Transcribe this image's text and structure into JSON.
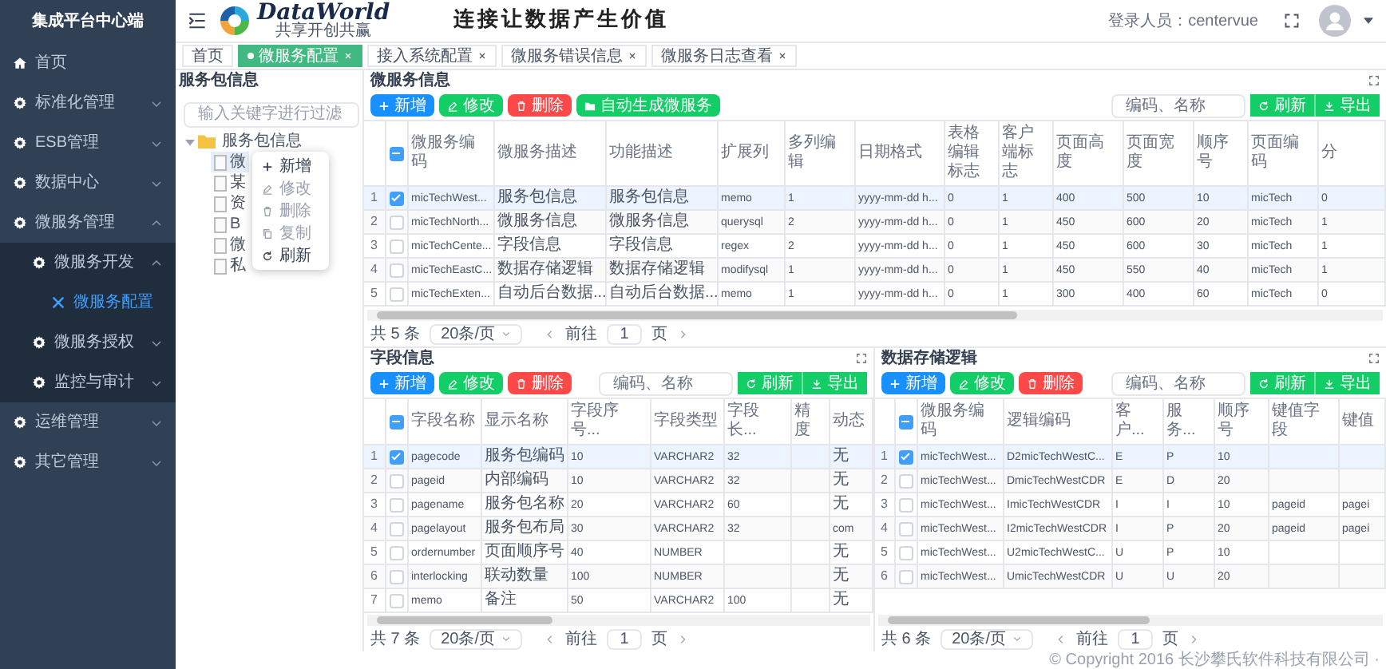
{
  "sidebar": {
    "title": "集成平台中心端",
    "items": [
      {
        "label": "首页",
        "kind": "home",
        "selected": false
      },
      {
        "label": "标准化管理",
        "kind": "group",
        "selected": false,
        "expanded": false
      },
      {
        "label": "ESB管理",
        "kind": "group",
        "selected": false,
        "expanded": false
      },
      {
        "label": "数据中心",
        "kind": "group",
        "selected": false,
        "expanded": false
      },
      {
        "label": "微服务管理",
        "kind": "group",
        "selected": false,
        "expanded": true,
        "children": [
          {
            "label": "微服务开发",
            "kind": "group",
            "selected": false,
            "expanded": true,
            "children": [
              {
                "label": "微服务配置",
                "kind": "page",
                "selected": true
              }
            ]
          },
          {
            "label": "微服务授权",
            "kind": "group",
            "selected": false,
            "expanded": false
          },
          {
            "label": "监控与审计",
            "kind": "group",
            "selected": false,
            "expanded": false
          }
        ]
      },
      {
        "label": "运维管理",
        "kind": "group",
        "selected": false,
        "expanded": false
      },
      {
        "label": "其它管理",
        "kind": "group",
        "selected": false,
        "expanded": false
      }
    ]
  },
  "header": {
    "logo_text": "DataWorld",
    "logo_subtitle": "共享开创共赢",
    "slogan": "连接让数据产生价值",
    "user": "登录人员：centervue"
  },
  "tabs": [
    {
      "label": "首页",
      "selected": false,
      "closable": false
    },
    {
      "label": "微服务配置",
      "selected": true,
      "closable": true
    },
    {
      "label": "接入系统配置",
      "selected": false,
      "closable": true
    },
    {
      "label": "微服务错误信息",
      "selected": false,
      "closable": true
    },
    {
      "label": "微服务日志查看",
      "selected": false,
      "closable": true
    }
  ],
  "tree_panel": {
    "title": "服务包信息",
    "filter_placeholder": "输入关键字进行过滤",
    "root": {
      "label": "服务包信息",
      "expanded": true,
      "children": [
        {
          "label": "微",
          "selected": true
        },
        {
          "label": "某",
          "selected": false
        },
        {
          "label": "资",
          "selected": false
        },
        {
          "label": "B",
          "selected": false
        },
        {
          "label": "微",
          "selected": false
        },
        {
          "label": "私",
          "selected": false
        }
      ]
    },
    "context_menu": [
      {
        "label": "新增",
        "kind": "add",
        "disabled": false
      },
      {
        "label": "修改",
        "kind": "edit",
        "disabled": true
      },
      {
        "label": "删除",
        "kind": "delete",
        "disabled": true
      },
      {
        "label": "复制",
        "kind": "copy",
        "disabled": true
      },
      {
        "label": "刷新",
        "kind": "refresh",
        "disabled": false
      }
    ]
  },
  "panels": [
    {
      "title": "微服务信息",
      "buttons": [
        {
          "label": "新增",
          "kind": "add"
        },
        {
          "label": "修改",
          "kind": "edit"
        },
        {
          "label": "删除",
          "kind": "delete"
        },
        {
          "label": "自动生成微服务",
          "kind": "generate"
        }
      ],
      "search_placeholder": "编码、名称",
      "tools": [
        {
          "label": "刷新",
          "kind": "refresh"
        },
        {
          "label": "导出",
          "kind": "export"
        }
      ],
      "table": {
        "header_checkbox": {
          "indeterminate": true
        },
        "columns": [
          "微服务编码",
          "微服务描述",
          "功能描述",
          "扩展列",
          "多列编辑",
          "日期格式",
          "表格编辑标志",
          "客户端标志",
          "页面高度",
          "页面宽度",
          "顺序号",
          "页面编码",
          "分"
        ],
        "rows": [
          {
            "index": "1",
            "checked": true,
            "selected": true,
            "cells": [
              "micTechWest...",
              "服务包信息",
              "服务包信息",
              "memo",
              "1",
              "yyyy-mm-dd h...",
              "0",
              "1",
              "400",
              "500",
              "10",
              "micTech",
              "0"
            ]
          },
          {
            "index": "2",
            "checked": false,
            "selected": false,
            "cells": [
              "micTechNorth...",
              "微服务信息",
              "微服务信息",
              "querysql",
              "2",
              "yyyy-mm-dd h...",
              "0",
              "1",
              "450",
              "600",
              "20",
              "micTech",
              "1"
            ]
          },
          {
            "index": "3",
            "checked": false,
            "selected": false,
            "cells": [
              "micTechCente...",
              "字段信息",
              "字段信息",
              "regex",
              "2",
              "yyyy-mm-dd h...",
              "0",
              "1",
              "450",
              "600",
              "30",
              "micTech",
              "1"
            ]
          },
          {
            "index": "4",
            "checked": false,
            "selected": false,
            "cells": [
              "micTechEastC...",
              "数据存储逻辑",
              "数据存储逻辑",
              "modifysql",
              "1",
              "yyyy-mm-dd h...",
              "0",
              "1",
              "450",
              "550",
              "40",
              "micTech",
              "1"
            ]
          },
          {
            "index": "5",
            "checked": false,
            "selected": false,
            "cells": [
              "micTechExten...",
              "自动后台数据...",
              "自动后台数据...",
              "memo",
              "1",
              "yyyy-mm-dd h...",
              "0",
              "1",
              "300",
              "400",
              "60",
              "micTech",
              "0"
            ]
          }
        ]
      },
      "pager": {
        "total": "共 5 条",
        "page_size": "20条/页",
        "goto_label": "前往",
        "page": "1",
        "page_unit": "页"
      }
    },
    {
      "title": "字段信息",
      "buttons": [
        {
          "label": "新增",
          "kind": "add"
        },
        {
          "label": "修改",
          "kind": "edit"
        },
        {
          "label": "删除",
          "kind": "delete"
        }
      ],
      "search_placeholder": "编码、名称",
      "tools": [
        {
          "label": "刷新",
          "kind": "refresh"
        },
        {
          "label": "导出",
          "kind": "export"
        }
      ],
      "table": {
        "header_checkbox": {
          "indeterminate": true
        },
        "columns": [
          "字段名称",
          "显示名称",
          "字段序号...",
          "字段类型",
          "字段长...",
          "精度",
          "动态"
        ],
        "rows": [
          {
            "index": "1",
            "checked": true,
            "selected": true,
            "cells": [
              "pagecode",
              "服务包编码",
              "10",
              "VARCHAR2",
              "32",
              null,
              "无"
            ]
          },
          {
            "index": "2",
            "checked": false,
            "selected": false,
            "cells": [
              "pageid",
              "内部编码",
              "10",
              "VARCHAR2",
              "32",
              null,
              "无"
            ]
          },
          {
            "index": "3",
            "checked": false,
            "selected": false,
            "cells": [
              "pagename",
              "服务包名称",
              "20",
              "VARCHAR2",
              "60",
              null,
              "无"
            ]
          },
          {
            "index": "4",
            "checked": false,
            "selected": false,
            "cells": [
              "pagelayout",
              "服务包布局",
              "30",
              "VARCHAR2",
              "32",
              null,
              "com"
            ]
          },
          {
            "index": "5",
            "checked": false,
            "selected": false,
            "cells": [
              "ordernumber",
              "页面顺序号",
              "40",
              "NUMBER",
              null,
              null,
              "无"
            ]
          },
          {
            "index": "6",
            "checked": false,
            "selected": false,
            "cells": [
              "interlocking",
              "联动数量",
              "100",
              "NUMBER",
              null,
              null,
              "无"
            ]
          },
          {
            "index": "7",
            "checked": false,
            "selected": false,
            "cells": [
              "memo",
              "备注",
              "50",
              "VARCHAR2",
              "100",
              null,
              "无"
            ]
          }
        ]
      },
      "pager": {
        "total": "共 7 条",
        "page_size": "20条/页",
        "goto_label": "前往",
        "page": "1",
        "page_unit": "页"
      }
    },
    {
      "title": "数据存储逻辑",
      "buttons": [
        {
          "label": "新增",
          "kind": "add"
        },
        {
          "label": "修改",
          "kind": "edit"
        },
        {
          "label": "删除",
          "kind": "delete"
        }
      ],
      "search_placeholder": "编码、名称",
      "tools": [
        {
          "label": "刷新",
          "kind": "refresh"
        },
        {
          "label": "导出",
          "kind": "export"
        }
      ],
      "table": {
        "header_checkbox": {
          "indeterminate": true
        },
        "columns": [
          "微服务编码",
          "逻辑编码",
          "客户...",
          "服务...",
          "顺序号",
          "键值字段",
          "键值"
        ],
        "rows": [
          {
            "index": "1",
            "checked": true,
            "selected": true,
            "cells": [
              "micTechWest...",
              "D2micTechWestC...",
              "E",
              "P",
              "10",
              null,
              null
            ]
          },
          {
            "index": "2",
            "checked": false,
            "selected": false,
            "cells": [
              "micTechWest...",
              "DmicTechWestCDR",
              "E",
              "D",
              "20",
              null,
              null
            ]
          },
          {
            "index": "3",
            "checked": false,
            "selected": false,
            "cells": [
              "micTechWest...",
              "ImicTechWestCDR",
              "I",
              "I",
              "10",
              "pageid",
              "pagei"
            ]
          },
          {
            "index": "4",
            "checked": false,
            "selected": false,
            "cells": [
              "micTechWest...",
              "I2micTechWestCDR",
              "I",
              "P",
              "20",
              "pageid",
              "pagei"
            ]
          },
          {
            "index": "5",
            "checked": false,
            "selected": false,
            "cells": [
              "micTechWest...",
              "U2micTechWestC...",
              "U",
              "P",
              "10",
              null,
              null
            ]
          },
          {
            "index": "6",
            "checked": false,
            "selected": false,
            "cells": [
              "micTechWest...",
              "UmicTechWestCDR",
              "U",
              "U",
              "20",
              null,
              null
            ]
          }
        ]
      },
      "pager": {
        "total": "共 6 条",
        "page_size": "20条/页",
        "goto_label": "前往",
        "page": "1",
        "page_unit": "页"
      }
    }
  ],
  "copyright": "© Copyright 2016 长沙攀氏软件科技有限公司 ·"
}
